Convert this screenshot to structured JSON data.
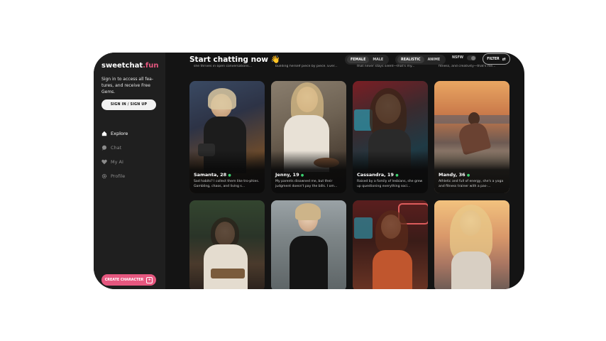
{
  "sidebar": {
    "brand": {
      "name": "sweetchat",
      "tld": ".fun"
    },
    "signin_text": "Sign in to access all fea-tures, and receive Free Gems.",
    "signin_button": "SIGN IN / SIGN UP",
    "nav": [
      {
        "label": "Explore",
        "icon": "home-icon",
        "active": true
      },
      {
        "label": "Chat",
        "icon": "chat-bubble-icon",
        "active": false
      },
      {
        "label": "My AI",
        "icon": "heart-icon",
        "active": false
      },
      {
        "label": "Profile",
        "icon": "gear-icon",
        "active": false
      }
    ],
    "create_button": "CREATE CHARACTER"
  },
  "header": {
    "title": "Start chatting now",
    "title_emoji": "👋",
    "gender_filters": [
      "FEMALE",
      "MALE"
    ],
    "style_filters": [
      "REALISTIC",
      "ANIME"
    ],
    "nsfw_label": "NSFW",
    "filter_label": "FILTER"
  },
  "top_snippets": [
    "she thrives in open conversations...",
    "building herself piece by piece. Ever...",
    "that never stays silent—that's my...",
    "fitness, and creativity—that's me..."
  ],
  "cards": [
    {
      "name": "Samanta, 28",
      "desc": "Sad habits? I collect them like tro-phies. Gambling, chaos, and living s..."
    },
    {
      "name": "Jenny, 19",
      "desc": "My parents disowned me, but their judgment doesn't pay the bills. I om..."
    },
    {
      "name": "Cassandra, 19",
      "desc": "Raised by a family of lesbians, she grew up questioning everything soci..."
    },
    {
      "name": "Mandy, 36",
      "desc": "Athletic and full of energy, she's a yoga and fitness trainer with a pas-..."
    }
  ],
  "colors": {
    "accent": "#e5577f",
    "online": "#3bd16f",
    "background": "#141414",
    "sidebar": "#1f1f1f"
  }
}
